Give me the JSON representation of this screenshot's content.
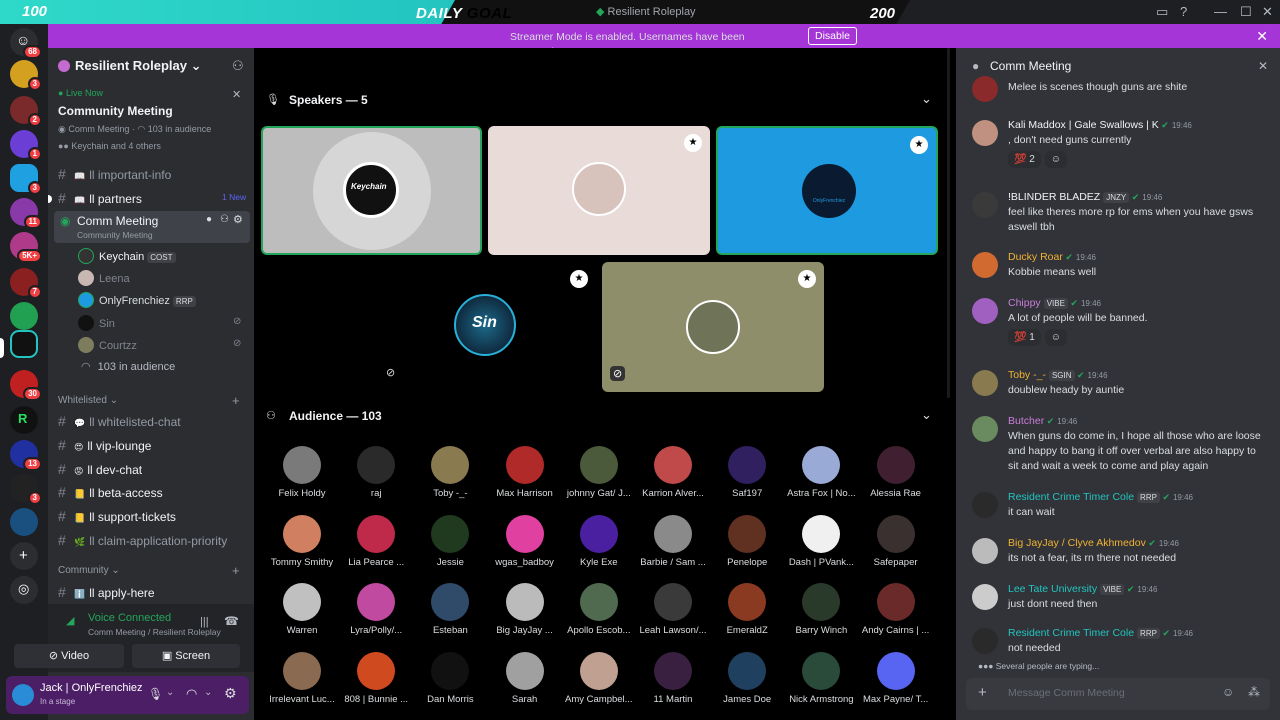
{
  "overlay": {
    "goal_min": "100",
    "goal_label_a": "DAILY",
    "goal_label_b": " GOAL",
    "goal_max": "200",
    "goal_progress": 0.5,
    "app_title": "Resilient Roleplay"
  },
  "banner": {
    "message": "Streamer Mode is enabled. Usernames have been truncated.",
    "disable_label": "Disable"
  },
  "rail": {
    "badges": [
      "68",
      "3",
      "2",
      "1",
      "3",
      "11",
      "5K+",
      "7",
      "30",
      "13",
      "3"
    ]
  },
  "server": {
    "name": "Resilient Roleplay"
  },
  "event": {
    "live": "Live Now",
    "title": "Community Meeting",
    "sub_a": "Comm Meeting",
    "sub_b": "103 in audience",
    "speakers": "Keychain and 4 others"
  },
  "channels": [
    {
      "label": "ll important-info",
      "emoji": "📖"
    },
    {
      "label": "ll partners",
      "emoji": "📖",
      "badge": "1 New"
    }
  ],
  "stage_channel": {
    "label": "Comm Meeting",
    "sub": "Community Meeting",
    "users": [
      {
        "name": "Keychain",
        "tag": "COST"
      },
      {
        "name": "Leena"
      },
      {
        "name": "OnlyFrenchiez",
        "tag": "RRP"
      },
      {
        "name": "Sin"
      },
      {
        "name": "Courtzz"
      }
    ],
    "audience": "103 in audience"
  },
  "whitelisted": {
    "title": "Whitelisted",
    "channels": [
      {
        "label": "ll whitelisted-chat",
        "emoji": "💬"
      },
      {
        "label": "ll vip-lounge",
        "emoji": "😍"
      },
      {
        "label": "ll dev-chat",
        "emoji": "😡"
      },
      {
        "label": "ll beta-access",
        "emoji": "📒"
      },
      {
        "label": "ll support-tickets",
        "emoji": "📒"
      },
      {
        "label": "ll claim-application-priority",
        "emoji": "🌿"
      }
    ]
  },
  "community": {
    "title": "Community",
    "channels": [
      {
        "label": "ll apply-here",
        "emoji": "ℹ️"
      }
    ]
  },
  "voice": {
    "status": "Voice Connected",
    "location": "Comm Meeting / Resilient Roleplay",
    "video_label": "Video",
    "screen_label": "Screen"
  },
  "user": {
    "name": "Jack | OnlyFrenchiez",
    "status": "In a stage"
  },
  "stage": {
    "speakers_label": "Speakers — 5",
    "audience_label": "Audience — 103",
    "speaker_tiles": [
      {
        "name": "Keychain",
        "bg": "#bdbdbd"
      },
      {
        "name": "Leena",
        "bg": "#e8dbd8"
      },
      {
        "name": "OnlyFrenchiez",
        "bg": "#1e9be0"
      },
      {
        "name": "Sin",
        "bg": "#000000"
      },
      {
        "name": "Courtzz",
        "bg": "#8e8e6a"
      }
    ],
    "audience": [
      "Felix Holdy",
      "raj",
      "Toby -_-",
      "Max Harrison",
      "johnny Gat/ J...",
      "Karrion Alver...",
      "Saf197",
      "Astra Fox | No...",
      "Alessia Rae",
      "Tommy Smithy",
      "Lia Pearce ...",
      "Jessie",
      "wgas_badboy",
      "Kyle Exe",
      "Barbie / Sam ...",
      "Penelope",
      "Dash | PVank...",
      "Safepaper",
      "Warren",
      "Lyra/Polly/...",
      "Esteban",
      "Big JayJay ...",
      "Apollo Escob...",
      "Leah Lawson/...",
      "EmeraldZ",
      "Barry Winch",
      "Andy Cairns | ...",
      "Irrelevant Luc...",
      "808 | Bunnie ...",
      "Dan Morris",
      "Sarah",
      "Amy Campbel...",
      "11 Martin",
      "James Doe",
      "Nick Armstrong",
      "Max Payne/ T..."
    ]
  },
  "chat": {
    "title": "Comm Meeting",
    "messages": [
      {
        "user": "",
        "time": "",
        "text": "Melee is scenes though guns are shite",
        "color": "#f2f3f5"
      },
      {
        "user": "Kali Maddox | Gale Swallows | K",
        "time": "19:46",
        "text": ", don't need guns currently",
        "color": "#f2f3f5",
        "react": "2"
      },
      {
        "user": "!BLINDER BLADEZ",
        "tag": "JNZY",
        "time": "19:46",
        "text": "feel like theres more rp for ems when you have gsws aswell tbh",
        "color": "#f2f3f5"
      },
      {
        "user": "Ducky Roar",
        "time": "19:46",
        "text": "Kobbie means well",
        "color": "#f0b232"
      },
      {
        "user": "Chippy",
        "tag": "VIBE",
        "time": "19:46",
        "text": "A lot of people will be banned.",
        "color": "#c97ed9",
        "react": "1"
      },
      {
        "user": "Toby -_-",
        "tag": "SGIN",
        "time": "19:46",
        "text": "doublew heady by auntie",
        "color": "#f0b232"
      },
      {
        "user": "Butcher",
        "time": "19:46",
        "text": "When guns do come in, I hope all those who are loose and happy to bang it off over verbal are also happy to sit and wait a week to come and play again",
        "color": "#c97ed9"
      },
      {
        "user": "Resident Crime Timer Cole",
        "tag": "RRP",
        "time": "19:46",
        "text": "it can wait",
        "color": "#23c4c0"
      },
      {
        "user": "Big JayJay",
        "time": "19:46",
        "text": "its not a fear, its rn there not needed",
        "color": "#f0b232",
        "extra": "/ Clyve Akhmedov"
      },
      {
        "user": "Lee Tate University",
        "tag": "VIBE",
        "time": "19:46",
        "text": "just dont need then",
        "color": "#23c4c0"
      },
      {
        "user": "Resident Crime Timer Cole",
        "tag": "RRP",
        "time": "19:46",
        "text": "not needed",
        "color": "#23c4c0"
      }
    ],
    "typing": "Several people are typing...",
    "placeholder": "Message Comm Meeting"
  }
}
